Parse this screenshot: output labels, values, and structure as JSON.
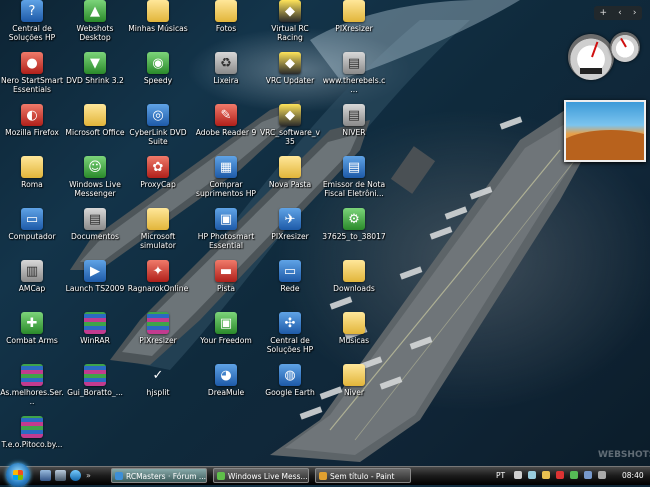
{
  "desktop": {
    "icons": [
      {
        "label": "Central de Soluções HP",
        "icon": "hp-help-icon",
        "glyph": "?",
        "style": "g-app"
      },
      {
        "label": "Webshots Desktop",
        "icon": "webshots-icon",
        "glyph": "▲",
        "style": "g-green"
      },
      {
        "label": "Minhas Músicas",
        "icon": "folder-icon",
        "glyph": "",
        "style": "g-folder"
      },
      {
        "label": "Fotos",
        "icon": "folder-icon",
        "glyph": "",
        "style": "g-folder"
      },
      {
        "label": "Virtual RC Racing",
        "icon": "racing-game-icon",
        "glyph": "◆",
        "style": "g-game"
      },
      {
        "label": "PIXresizer",
        "icon": "folder-icon",
        "glyph": "",
        "style": "g-folder"
      },
      {
        "label": "Nero StartSmart Essentials",
        "icon": "nero-icon",
        "glyph": "●",
        "style": "g-red"
      },
      {
        "label": "DVD Shrink 3.2",
        "icon": "dvd-shrink-icon",
        "glyph": "▼",
        "style": "g-green"
      },
      {
        "label": "Speedy",
        "icon": "speedy-icon",
        "glyph": "◉",
        "style": "g-green"
      },
      {
        "label": "Lixeira",
        "icon": "recycle-bin-icon",
        "glyph": "♻",
        "style": "g-gray"
      },
      {
        "label": "VRC Updater",
        "icon": "updater-icon",
        "glyph": "◆",
        "style": "g-game"
      },
      {
        "label": "www.therebels.c...",
        "icon": "web-shortcut-icon",
        "glyph": "▤",
        "style": "g-gray"
      },
      {
        "label": "Mozilla Firefox",
        "icon": "firefox-icon",
        "glyph": "◐",
        "style": "g-red"
      },
      {
        "label": "Microsoft Office",
        "icon": "folder-icon",
        "glyph": "",
        "style": "g-folder"
      },
      {
        "label": "CyberLink DVD Suite",
        "icon": "cyberlink-icon",
        "glyph": "◎",
        "style": "g-app"
      },
      {
        "label": "Adobe Reader 9",
        "icon": "adobe-reader-icon",
        "glyph": "✎",
        "style": "g-red"
      },
      {
        "label": "VRC_software_v35",
        "icon": "vrc-software-icon",
        "glyph": "◆",
        "style": "g-game"
      },
      {
        "label": "NIVER",
        "icon": "document-icon",
        "glyph": "▤",
        "style": "g-gray"
      },
      {
        "label": "Roma",
        "icon": "folder-icon",
        "glyph": "",
        "style": "g-folder"
      },
      {
        "label": "Windows Live Messenger",
        "icon": "messenger-icon",
        "glyph": "☺",
        "style": "g-green"
      },
      {
        "label": "ProxyCap",
        "icon": "proxycap-icon",
        "glyph": "✿",
        "style": "g-red"
      },
      {
        "label": "Comprar suprimentos HP",
        "icon": "hp-supplies-icon",
        "glyph": "▦",
        "style": "g-app"
      },
      {
        "label": "Nova Pasta",
        "icon": "folder-icon",
        "glyph": "",
        "style": "g-folder"
      },
      {
        "label": "Emissor de Nota Fiscal Eletrôni...",
        "icon": "invoice-app-icon",
        "glyph": "▤",
        "style": "g-app"
      },
      {
        "label": "Computador",
        "icon": "computer-icon",
        "glyph": "▭",
        "style": "g-app"
      },
      {
        "label": "Documentos",
        "icon": "documents-icon",
        "glyph": "▤",
        "style": "g-gray"
      },
      {
        "label": "Microsoft simulator",
        "icon": "folder-icon",
        "glyph": "",
        "style": "g-folder"
      },
      {
        "label": "HP Photosmart Essential",
        "icon": "hp-photosmart-icon",
        "glyph": "▣",
        "style": "g-app"
      },
      {
        "label": "PIXresizer",
        "icon": "pixresizer-icon",
        "glyph": "✈",
        "style": "g-app"
      },
      {
        "label": "37625_to_38017",
        "icon": "patch-icon",
        "glyph": "⚙",
        "style": "g-green"
      },
      {
        "label": "AMCap",
        "icon": "amcap-icon",
        "glyph": "▥",
        "style": "g-gray"
      },
      {
        "label": "Launch TS2009",
        "icon": "train-sim-icon",
        "glyph": "▶",
        "style": "g-app"
      },
      {
        "label": "RagnarokOnline",
        "icon": "ragnarok-icon",
        "glyph": "✦",
        "style": "g-red"
      },
      {
        "label": "Pista",
        "icon": "image-file-icon",
        "glyph": "▬",
        "style": "g-red"
      },
      {
        "label": "Rede",
        "icon": "network-icon",
        "glyph": "▭",
        "style": "g-app"
      },
      {
        "label": "Downloads",
        "icon": "folder-icon",
        "glyph": "",
        "style": "g-folder"
      },
      {
        "label": "Combat Arms",
        "icon": "combat-arms-icon",
        "glyph": "✚",
        "style": "g-green"
      },
      {
        "label": "WinRAR",
        "icon": "winrar-icon",
        "glyph": "",
        "style": "g-winrar"
      },
      {
        "label": "PIXresizer",
        "icon": "winrar-archive-icon",
        "glyph": "",
        "style": "g-winrar"
      },
      {
        "label": "Your Freedom",
        "icon": "your-freedom-icon",
        "glyph": "▣",
        "style": "g-green"
      },
      {
        "label": "Central de Soluções HP",
        "icon": "hp-help-icon",
        "glyph": "✣",
        "style": "g-app"
      },
      {
        "label": "Musicas",
        "icon": "folder-icon",
        "glyph": "",
        "style": "g-folder"
      },
      {
        "label": "As.melhores.Ser...",
        "icon": "winrar-archive-icon",
        "glyph": "",
        "style": "g-winrar"
      },
      {
        "label": "Gui_Boratto_...",
        "icon": "winrar-archive-icon",
        "glyph": "",
        "style": "g-winrar"
      },
      {
        "label": "hjsplit",
        "icon": "checkmark-icon",
        "glyph": "✓",
        "style": "g-none"
      },
      {
        "label": "DreaMule",
        "icon": "dreamule-icon",
        "glyph": "◕",
        "style": "g-app"
      },
      {
        "label": "Google Earth",
        "icon": "google-earth-icon",
        "glyph": "◍",
        "style": "g-app"
      },
      {
        "label": "Niver",
        "icon": "folder-icon",
        "glyph": "",
        "style": "g-folder"
      },
      {
        "label": "T.e.o.Pitoco.by...",
        "icon": "winrar-archive-icon",
        "glyph": "",
        "style": "g-winrar"
      }
    ]
  },
  "sidebar": {
    "controls": [
      "+",
      "‹",
      "›"
    ],
    "cpu_gauge_label": "",
    "photo_gadget": "desert-photo"
  },
  "taskbar": {
    "start_icon": "windows-start-orb",
    "quick_launch": [
      "show-desktop-icon",
      "switch-windows-icon",
      "ie-icon"
    ],
    "buttons": [
      {
        "label": "RCMasters · Fórum ...",
        "icon": "browser-icon",
        "color": "#3d8fd6"
      },
      {
        "label": "Windows Live Mess...",
        "icon": "messenger-icon",
        "color": "#5fbf4a"
      },
      {
        "label": "Sem título - Paint",
        "icon": "paint-icon",
        "color": "#e0a030"
      }
    ],
    "language": "PT",
    "clock": "08:40"
  },
  "watermark": "WEBSHOTS"
}
